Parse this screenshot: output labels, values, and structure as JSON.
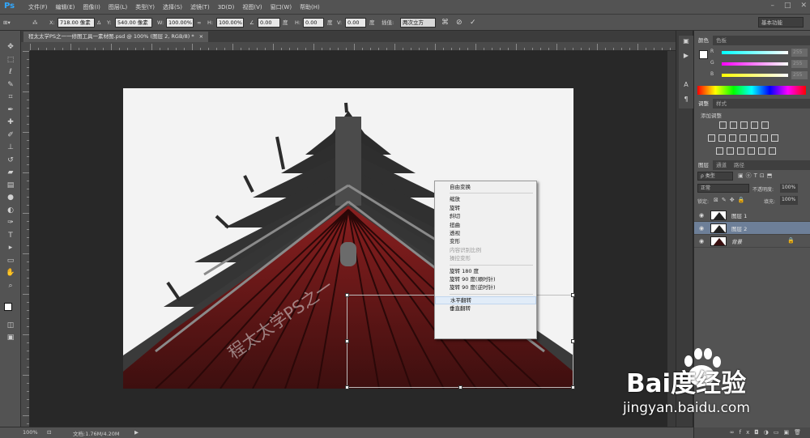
{
  "app": {
    "logo": "Ps"
  },
  "menu": [
    "文件(F)",
    "编辑(E)",
    "图像(I)",
    "图层(L)",
    "类型(Y)",
    "选择(S)",
    "滤镜(T)",
    "3D(D)",
    "视图(V)",
    "窗口(W)",
    "帮助(H)"
  ],
  "options": {
    "x_label": "X:",
    "x_value": "718.00 像素",
    "y_label": "Y:",
    "y_value": "540.00 像素",
    "w_label": "W:",
    "w_value": "100.00%",
    "h_label": "H:",
    "h_value": "100.00%",
    "angle_value": "0.00",
    "angle_unit": "度",
    "hskew_label": "H:",
    "hskew_value": "0.00",
    "hskew_unit": "度",
    "vskew_label": "V:",
    "vskew_value": "0.00",
    "vskew_unit": "度",
    "interp_label": "插值:",
    "interp_value": "两次立方",
    "workspace": "基本功能"
  },
  "document": {
    "tab_title": "程太太学PS之一一修图工具一素材图.psd @ 100% (图层 2, RGB/8) *"
  },
  "canvas": {
    "watermark": "程太太学PS之一"
  },
  "context_menu": {
    "items": [
      {
        "label": "自由变换",
        "state": "normal"
      },
      {
        "label": "缩放",
        "state": "normal"
      },
      {
        "label": "旋转",
        "state": "normal"
      },
      {
        "label": "斜切",
        "state": "normal"
      },
      {
        "label": "扭曲",
        "state": "normal"
      },
      {
        "label": "透视",
        "state": "normal"
      },
      {
        "label": "变形",
        "state": "normal"
      },
      {
        "label": "内容识别比例",
        "state": "disabled"
      },
      {
        "label": "操控变形",
        "state": "disabled"
      },
      {
        "label": "旋转 180 度",
        "state": "normal"
      },
      {
        "label": "旋转 90 度(顺时针)",
        "state": "normal"
      },
      {
        "label": "旋转 90 度(逆时针)",
        "state": "normal"
      },
      {
        "label": "水平翻转",
        "state": "highlighted"
      },
      {
        "label": "垂直翻转",
        "state": "normal"
      }
    ]
  },
  "status": {
    "zoom": "100%",
    "doc_info": "文档:1.76M/4.20M"
  },
  "color_panel": {
    "tabs": [
      "颜色",
      "色板"
    ],
    "r_label": "R",
    "r_value": "255",
    "g_label": "G",
    "g_value": "255",
    "b_label": "B",
    "b_value": "255"
  },
  "adjust_panel": {
    "tabs": [
      "调整",
      "样式"
    ],
    "add_label": "添加调整"
  },
  "layers_panel": {
    "tabs": [
      "图层",
      "通道",
      "路径"
    ],
    "filter_kind": "ρ 类型",
    "blend_mode": "正常",
    "opacity_label": "不透明度:",
    "opacity_value": "100%",
    "lock_label": "锁定:",
    "fill_label": "填充:",
    "fill_value": "100%",
    "layers": [
      {
        "name": "图层 1",
        "selected": false,
        "locked": false
      },
      {
        "name": "图层 2",
        "selected": true,
        "locked": false
      },
      {
        "name": "背景",
        "selected": false,
        "locked": true
      }
    ]
  },
  "watermark_site": {
    "brand": "Bai度经验",
    "url": "jingyan.baidu.com"
  },
  "colors": {
    "accent": "#31a8ff",
    "panel_bg": "#535353",
    "canvas_bg": "#282828",
    "selection": "#6d7f98"
  }
}
